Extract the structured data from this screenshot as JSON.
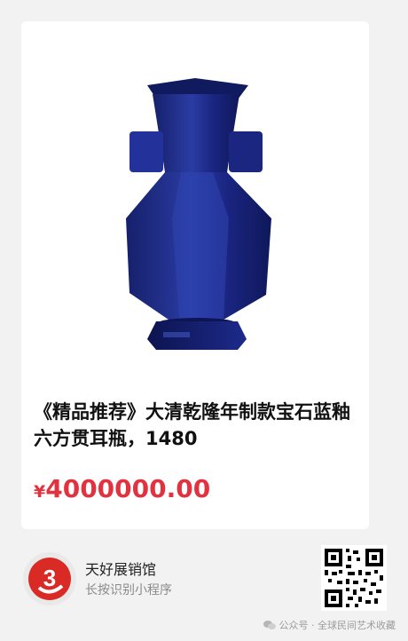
{
  "product": {
    "title": "《精品推荐》大清乾隆年制款宝石蓝釉六方贯耳瓶，1480",
    "currency": "¥",
    "price": "4000000.00"
  },
  "footer": {
    "app_name": "天好展销馆",
    "app_hint": "长按识别小程序",
    "logo_text": "3"
  },
  "watermark": {
    "text": "公众号 · 全球民间艺术收藏"
  },
  "icons": {
    "product_image": "vase-image",
    "logo": "app-logo-icon",
    "qr": "qr-code-icon",
    "watermark": "wechat-icon"
  },
  "colors": {
    "price": "#e2323f",
    "vase": "#1e2f8c",
    "logo_red": "#d92a25"
  }
}
